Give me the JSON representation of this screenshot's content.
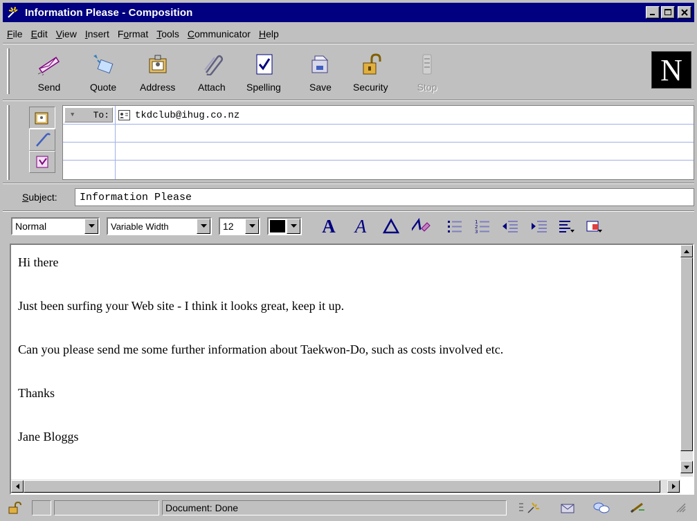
{
  "window": {
    "title": "Information Please - Composition",
    "accent_color": "#000080",
    "icons": [
      "compose-app-icon",
      "minimize-icon",
      "maximize-icon",
      "close-icon"
    ]
  },
  "menu": [
    {
      "underline": "F",
      "rest": "ile"
    },
    {
      "underline": "E",
      "rest": "dit"
    },
    {
      "underline": "V",
      "rest": "iew"
    },
    {
      "underline": "I",
      "rest": "nsert"
    },
    {
      "pre": "F",
      "underline": "o",
      "rest": "rmat"
    },
    {
      "underline": "T",
      "rest": "ools"
    },
    {
      "underline": "C",
      "rest": "ommunicator"
    },
    {
      "underline": "H",
      "rest": "elp"
    }
  ],
  "toolbar": {
    "send": "Send",
    "quote": "Quote",
    "address": "Address",
    "attach": "Attach",
    "spelling": "Spelling",
    "save": "Save",
    "security": "Security",
    "stop": "Stop",
    "logo": "N"
  },
  "addressing": {
    "to_label": "To:",
    "recipient": "tkdclub@ihug.co.nz"
  },
  "subject": {
    "label_underline": "S",
    "label_rest": "ubject:",
    "value": "Information Please"
  },
  "format": {
    "paragraph_style": "Normal",
    "font": "Variable Width",
    "size": "12",
    "text_color": "#000000"
  },
  "body": {
    "lines": [
      "Hi there",
      "Just been surfing your Web site - I think it looks great, keep it up.",
      "Can you please send me some further information about Taekwon-Do, such as costs involved etc.",
      "Thanks",
      "Jane Bloggs"
    ]
  },
  "status": {
    "text": "Document: Done"
  }
}
